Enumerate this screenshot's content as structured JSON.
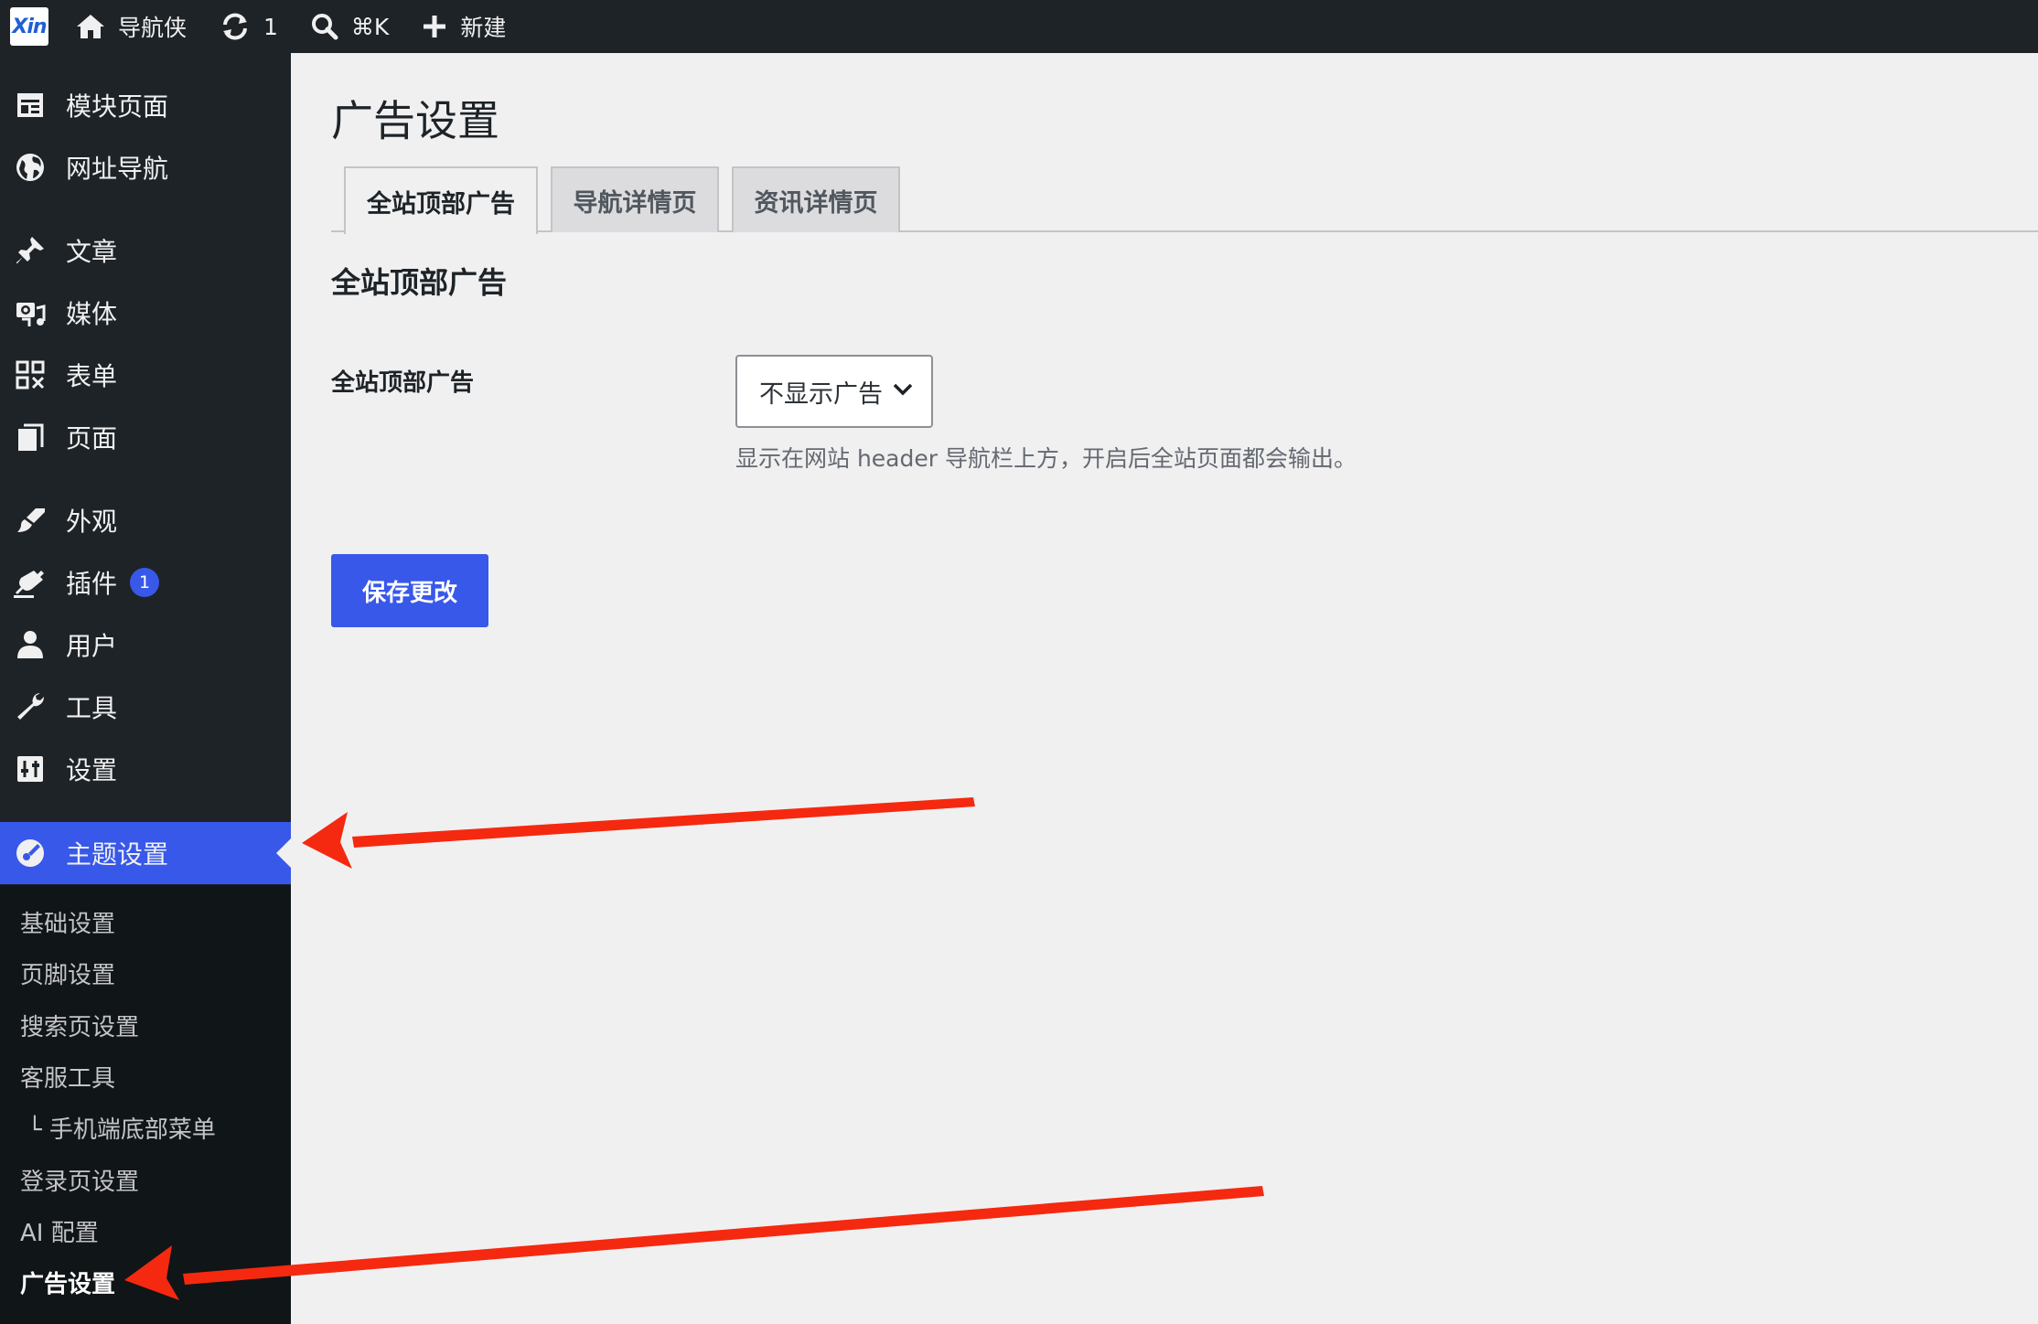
{
  "adminbar": {
    "logo_text": "Xin",
    "site_name": "导航侠",
    "updates_count": "1",
    "search_shortcut": "⌘K",
    "new_label": "新建"
  },
  "sidebar": {
    "items": [
      {
        "label": "模块页面",
        "icon": "layout-icon"
      },
      {
        "label": "网址导航",
        "icon": "globe-icon"
      },
      {
        "label": "文章",
        "icon": "pin-icon"
      },
      {
        "label": "媒体",
        "icon": "media-icon"
      },
      {
        "label": "表单",
        "icon": "grid-icon"
      },
      {
        "label": "页面",
        "icon": "page-icon"
      },
      {
        "label": "外观",
        "icon": "brush-icon"
      },
      {
        "label": "插件",
        "icon": "plugin-icon",
        "badge": "1"
      },
      {
        "label": "用户",
        "icon": "user-icon"
      },
      {
        "label": "工具",
        "icon": "wrench-icon"
      },
      {
        "label": "设置",
        "icon": "settings-icon"
      },
      {
        "label": "主题设置",
        "icon": "theme-icon",
        "active": true
      }
    ],
    "submenu": [
      {
        "label": "基础设置"
      },
      {
        "label": "页脚设置"
      },
      {
        "label": "搜索页设置"
      },
      {
        "label": "客服工具"
      },
      {
        "label": "└ 手机端底部菜单"
      },
      {
        "label": "登录页设置"
      },
      {
        "label": "AI 配置"
      },
      {
        "label": "广告设置",
        "current": true
      }
    ]
  },
  "main": {
    "page_title": "广告设置",
    "tabs": [
      {
        "label": "全站顶部广告",
        "active": true
      },
      {
        "label": "导航详情页"
      },
      {
        "label": "资讯详情页"
      }
    ],
    "section_title": "全站顶部广告",
    "field": {
      "label": "全站顶部广告",
      "selected_value": "不显示广告",
      "description": "显示在网站 header 导航栏上方，开启后全站页面都会输出。"
    },
    "save_label": "保存更改"
  },
  "colors": {
    "adminbar_bg": "#1d2327",
    "sidebar_bg": "#1d2327",
    "submenu_bg": "#101517",
    "accent": "#3858e9",
    "annotation_arrow": "#f5290f"
  }
}
